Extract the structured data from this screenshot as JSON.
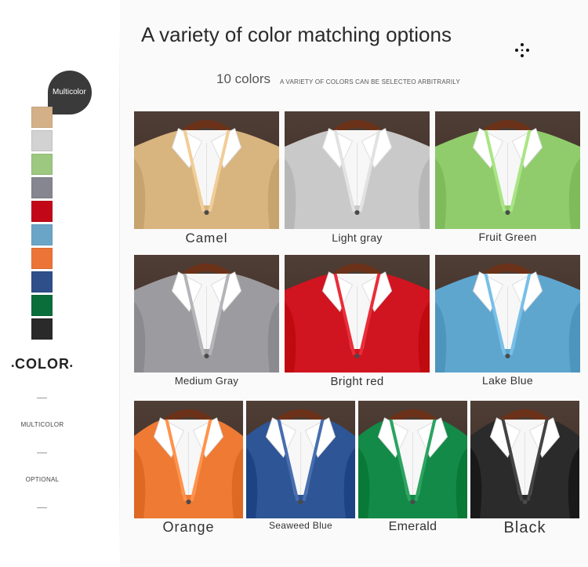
{
  "header": {
    "title": "A variety of color matching options",
    "subtitle_main": "10 colors",
    "subtitle_small": "A VARIETY OF COLORS CAN BE SELECTEO ARBITRARILY",
    "menu_icon": "dots-icon"
  },
  "sidebar": {
    "badge": "Multicolor",
    "swatches": [
      "#d4b088",
      "#d2d2d2",
      "#9cc87f",
      "#868690",
      "#c20818",
      "#6aa5c8",
      "#ec7436",
      "#2e4f8a",
      "#0a6e3b",
      "#2a2a2a"
    ],
    "heading": "COLOR",
    "label_multicolor": "MULTICOLOR",
    "label_optional": "OPTIONAL"
  },
  "colors": {
    "background_dark": "#3b2a22",
    "hanger": "#6b3219",
    "shirt": "#f7f7f7"
  },
  "products": [
    {
      "name": "Camel",
      "color": "#d8b47f"
    },
    {
      "name": "Light gray",
      "color": "#c9c9c9"
    },
    {
      "name": "Fruit Green",
      "color": "#90cc6c"
    },
    {
      "name": "Medium Gray",
      "color": "#9c9ca0"
    },
    {
      "name": "Bright red",
      "color": "#d01420"
    },
    {
      "name": "Lake Blue",
      "color": "#5fa6cf"
    },
    {
      "name": "Orange",
      "color": "#ee7a34"
    },
    {
      "name": "Seaweed Blue",
      "color": "#2e5596"
    },
    {
      "name": "Emerald",
      "color": "#138a48"
    },
    {
      "name": "Black",
      "color": "#2b2b2b"
    }
  ]
}
